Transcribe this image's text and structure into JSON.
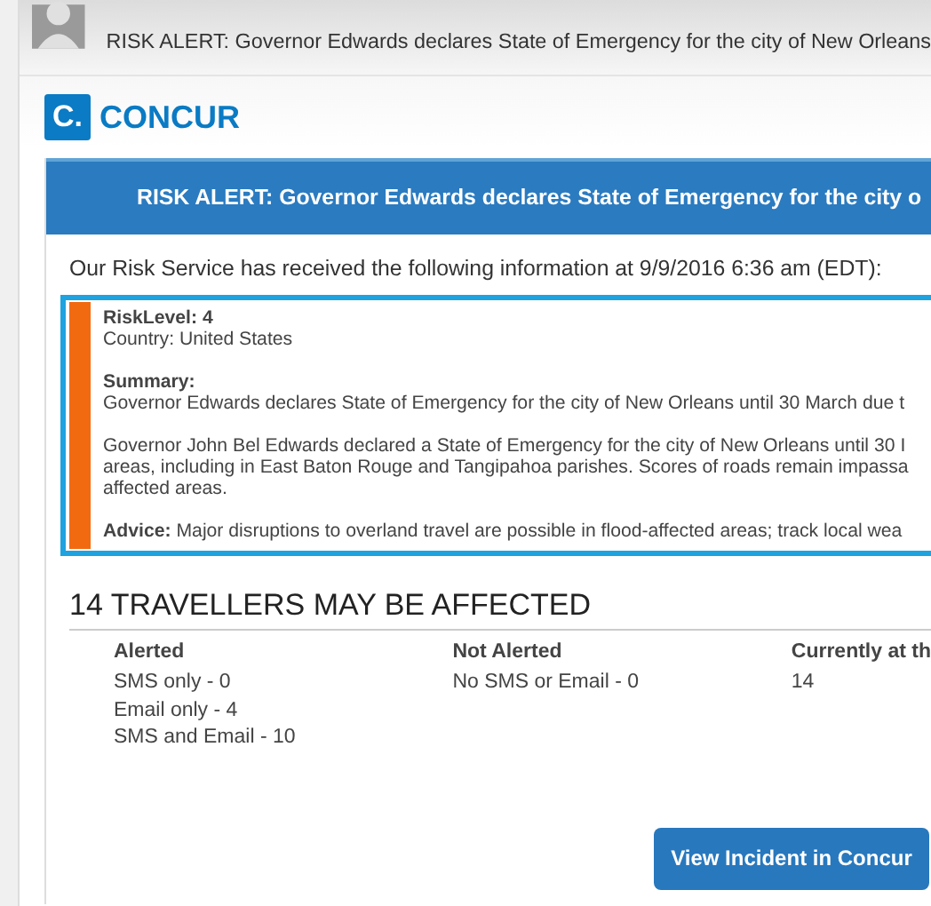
{
  "email": {
    "subject": "RISK ALERT: Governor Edwards declares State of Emergency for the city of New Orleans"
  },
  "brand": {
    "logo_letter": "C.",
    "name": "CONCUR"
  },
  "banner": {
    "title": "RISK ALERT: Governor Edwards declares State of Emergency for the city o"
  },
  "intro": "Our Risk Service has received the following information at 9/9/2016  6:36 am (EDT):",
  "alert": {
    "risk_level": "RiskLevel: 4",
    "country": "Country: United States",
    "summary_label": "Summary:",
    "summary": "Governor Edwards declares State of Emergency for the city of New Orleans until 30 March due t",
    "details": [
      "Governor John Bel Edwards declared a State of Emergency for the city of New Orleans until 30 I",
      "areas, including in East Baton Rouge and Tangipahoa parishes. Scores of roads remain impassa",
      "affected areas."
    ],
    "advice": "**Advice:** Major disruptions to overland travel are possible in flood-affected areas; track local wea"
  },
  "travellers": {
    "heading": "14 TRAVELLERS MAY BE AFFECTED",
    "columns": [
      {
        "title": "Alerted",
        "items": [
          "SMS only - 0",
          "Email only - 4",
          "SMS and Email - 10"
        ]
      },
      {
        "title": "Not Alerted",
        "items": [
          "No SMS or Email - 0"
        ]
      },
      {
        "title": "Currently at th",
        "items": [
          "14"
        ]
      }
    ]
  },
  "button": "View Incident in Concur"
}
